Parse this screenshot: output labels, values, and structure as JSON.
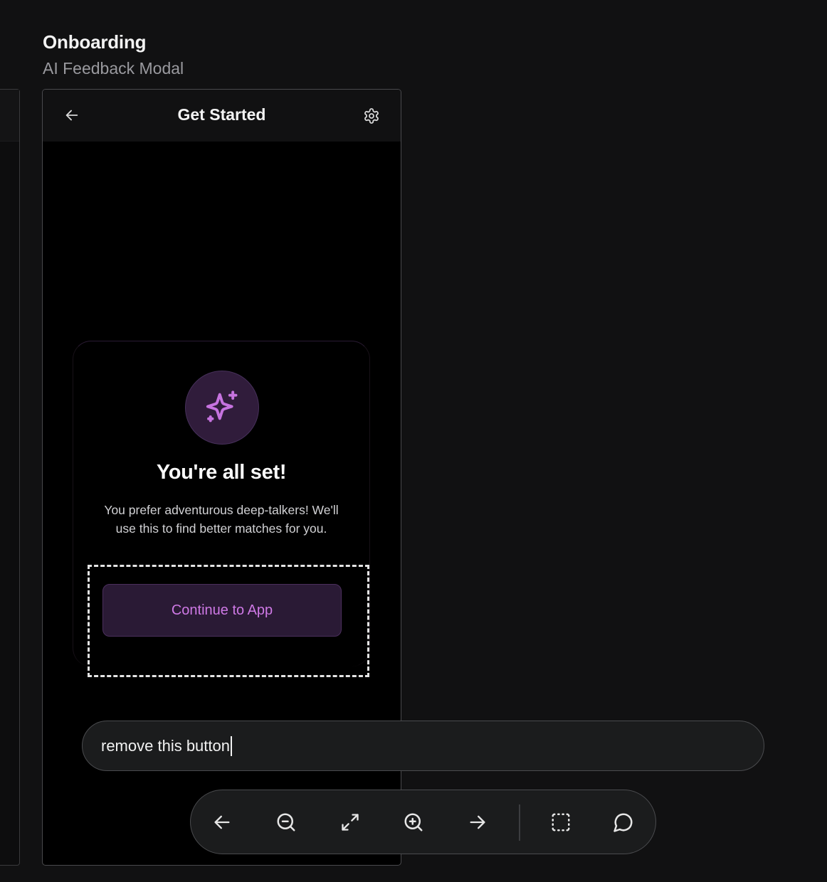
{
  "section": {
    "title": "Onboarding",
    "subtitle": "AI Feedback Modal"
  },
  "phone": {
    "header": {
      "title": "Get Started",
      "back_icon": "arrow-left-icon",
      "settings_icon": "gear-icon"
    },
    "modal": {
      "icon": "sparkle-icon",
      "heading": "You're all set!",
      "body": "You prefer adventurous deep-talkers! We'll use this to find better matches for you.",
      "button_label": "Continue to App"
    }
  },
  "prompt": {
    "value": "remove this button"
  },
  "toolbar": {
    "items": [
      {
        "icon": "arrow-left-icon"
      },
      {
        "icon": "zoom-out-icon"
      },
      {
        "icon": "fullscreen-icon"
      },
      {
        "icon": "zoom-in-icon"
      },
      {
        "icon": "arrow-right-icon"
      },
      {
        "icon": "select-region-icon"
      },
      {
        "icon": "comment-icon"
      }
    ]
  },
  "colors": {
    "background": "#111112",
    "accent": "#cf79e6",
    "button_bg": "#2a1a35",
    "badge_bg": "#301c3b"
  }
}
